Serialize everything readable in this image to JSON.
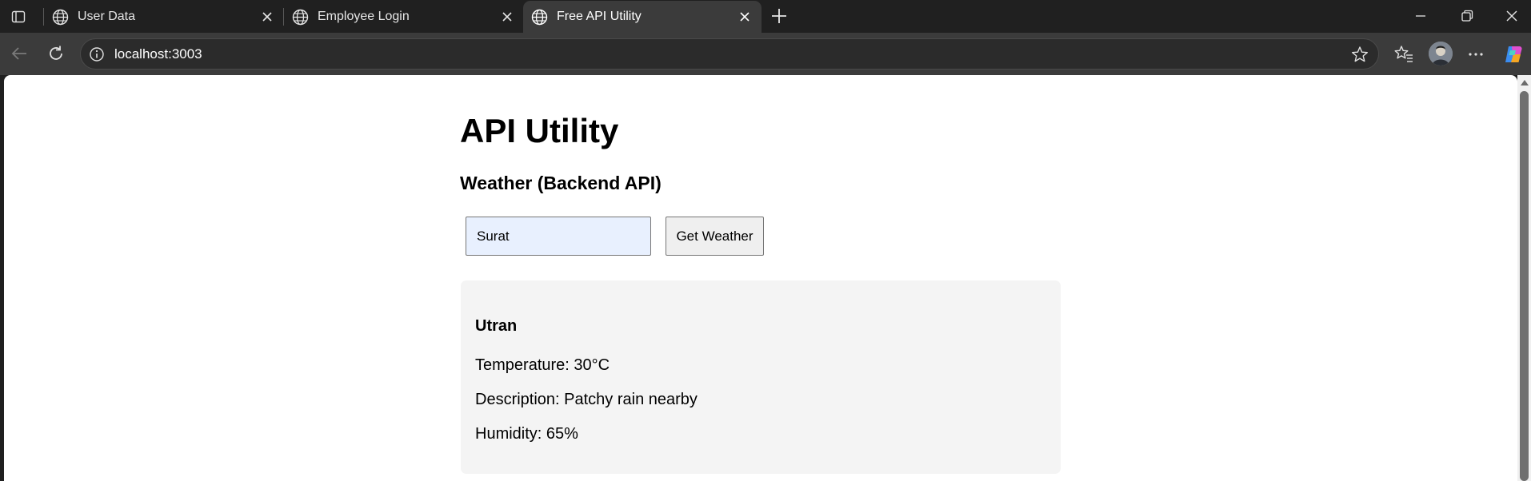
{
  "browser": {
    "tabs": [
      {
        "title": "User Data",
        "active": false
      },
      {
        "title": "Employee Login",
        "active": false
      },
      {
        "title": "Free API Utility",
        "active": true
      }
    ],
    "address": "localhost:3003"
  },
  "page": {
    "title": "API Utility",
    "section_title": "Weather (Backend API)",
    "city_input_value": "Surat",
    "get_weather_label": "Get Weather",
    "result": {
      "location": "Utran",
      "temperature": "Temperature: 30°C",
      "description": "Description: Patchy rain nearby",
      "humidity": "Humidity: 65%"
    }
  },
  "colors": {
    "accent_tab_active": "#3b3b3b",
    "input_autofill_bg": "#e8f0fe",
    "card_bg": "#f4f4f4"
  }
}
